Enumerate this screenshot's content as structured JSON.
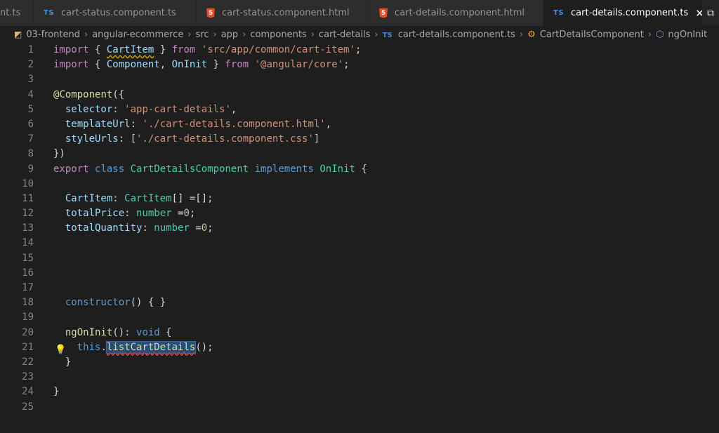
{
  "tabs": [
    {
      "name": "tab-t-ts",
      "label": "nt.ts",
      "icon": "none",
      "active": false
    },
    {
      "name": "tab-cart-status-ts",
      "label": "cart-status.component.ts",
      "icon": "ts-icon",
      "active": false
    },
    {
      "name": "tab-cart-status-html",
      "label": "cart-status.component.html",
      "icon": "html-icon",
      "active": false
    },
    {
      "name": "tab-cart-details-html",
      "label": "cart-details.component.html",
      "icon": "html-icon",
      "active": false
    },
    {
      "name": "tab-cart-details-ts",
      "label": "cart-details.component.ts",
      "icon": "ts-icon",
      "active": true
    }
  ],
  "breadcrumb": {
    "items": [
      "03-frontend",
      "angular-ecommerce",
      "src",
      "app",
      "components",
      "cart-details",
      "cart-details.component.ts",
      "CartDetailsComponent",
      "ngOnInit"
    ]
  },
  "icons": {
    "ts": "TS",
    "html": "5",
    "close": "✕",
    "folder": "◩",
    "class": "⚙",
    "method": "⬡",
    "bulb": "💡",
    "split": "⧉",
    "chevron": "›"
  },
  "line_numbers": [
    "1",
    "2",
    "3",
    "4",
    "5",
    "6",
    "7",
    "8",
    "9",
    "10",
    "11",
    "12",
    "13",
    "14",
    "15",
    "16",
    "17",
    "18",
    "19",
    "20",
    "21",
    "22",
    "23",
    "24",
    "25"
  ],
  "code_lines": [
    [
      [
        "k-import",
        "import"
      ],
      [
        "t-punc",
        " { "
      ],
      [
        "t-var squiggle-warn",
        "CartItem"
      ],
      [
        "t-punc",
        " } "
      ],
      [
        "k-import",
        "from"
      ],
      [
        "t-punc",
        " "
      ],
      [
        "t-str",
        "'src/app/common/cart-item'"
      ],
      [
        "t-punc",
        ";"
      ]
    ],
    [
      [
        "k-import",
        "import"
      ],
      [
        "t-punc",
        " { "
      ],
      [
        "t-var",
        "Component"
      ],
      [
        "t-punc",
        ", "
      ],
      [
        "t-var",
        "OnInit"
      ],
      [
        "t-punc",
        " } "
      ],
      [
        "k-import",
        "from"
      ],
      [
        "t-punc",
        " "
      ],
      [
        "t-str",
        "'@angular/core'"
      ],
      [
        "t-punc",
        ";"
      ]
    ],
    [],
    [
      [
        "t-deco",
        "@"
      ],
      [
        "t-deco",
        "Component"
      ],
      [
        "t-punc",
        "({"
      ]
    ],
    [
      [
        "t-punc",
        "  "
      ],
      [
        "t-var",
        "selector"
      ],
      [
        "t-punc",
        ": "
      ],
      [
        "t-str",
        "'app-cart-details'"
      ],
      [
        "t-punc",
        ","
      ]
    ],
    [
      [
        "t-punc",
        "  "
      ],
      [
        "t-var",
        "templateUrl"
      ],
      [
        "t-punc",
        ": "
      ],
      [
        "t-str",
        "'./cart-details.component.html'"
      ],
      [
        "t-punc",
        ","
      ]
    ],
    [
      [
        "t-punc",
        "  "
      ],
      [
        "t-var",
        "styleUrls"
      ],
      [
        "t-punc",
        ": ["
      ],
      [
        "t-str",
        "'./cart-details.component.css'"
      ],
      [
        "t-punc",
        "]"
      ]
    ],
    [
      [
        "t-punc",
        "})"
      ]
    ],
    [
      [
        "k-import",
        "export"
      ],
      [
        "t-punc",
        " "
      ],
      [
        "k-blue",
        "class"
      ],
      [
        "t-punc",
        " "
      ],
      [
        "t-type",
        "CartDetailsComponent"
      ],
      [
        "t-punc",
        " "
      ],
      [
        "k-blue",
        "implements"
      ],
      [
        "t-punc",
        " "
      ],
      [
        "t-type",
        "OnInit"
      ],
      [
        "t-punc",
        " {"
      ]
    ],
    [],
    [
      [
        "t-punc",
        "  "
      ],
      [
        "t-var",
        "CartItem"
      ],
      [
        "t-punc",
        ": "
      ],
      [
        "t-type",
        "CartItem"
      ],
      [
        "t-punc",
        "[] =[];"
      ]
    ],
    [
      [
        "t-punc",
        "  "
      ],
      [
        "t-var",
        "totalPrice"
      ],
      [
        "t-punc",
        ": "
      ],
      [
        "t-type",
        "number"
      ],
      [
        "t-punc",
        " ="
      ],
      [
        "t-num",
        "0"
      ],
      [
        "t-punc",
        ";"
      ]
    ],
    [
      [
        "t-punc",
        "  "
      ],
      [
        "t-var",
        "totalQuantity"
      ],
      [
        "t-punc",
        ": "
      ],
      [
        "t-type",
        "number"
      ],
      [
        "t-punc",
        " ="
      ],
      [
        "t-num",
        "0"
      ],
      [
        "t-punc",
        ";"
      ]
    ],
    [],
    [],
    [],
    [],
    [
      [
        "t-punc",
        "  "
      ],
      [
        "k-blue",
        "constructor"
      ],
      [
        "t-punc",
        "() { }"
      ]
    ],
    [],
    [
      [
        "t-punc",
        "  "
      ],
      [
        "t-fn",
        "ngOnInit"
      ],
      [
        "t-punc",
        "(): "
      ],
      [
        "k-blue",
        "void"
      ],
      [
        "t-punc",
        " {"
      ]
    ],
    [
      [
        "t-punc",
        "    "
      ],
      [
        "k-blue",
        "this"
      ],
      [
        "t-punc",
        "."
      ],
      [
        "t-fn sel squiggle-err",
        "listCartDetails"
      ],
      [
        "t-punc",
        "();"
      ]
    ],
    [
      [
        "t-punc",
        "  }"
      ]
    ],
    [],
    [
      [
        "t-punc",
        "}"
      ]
    ],
    []
  ],
  "lightbulb_line": 21
}
